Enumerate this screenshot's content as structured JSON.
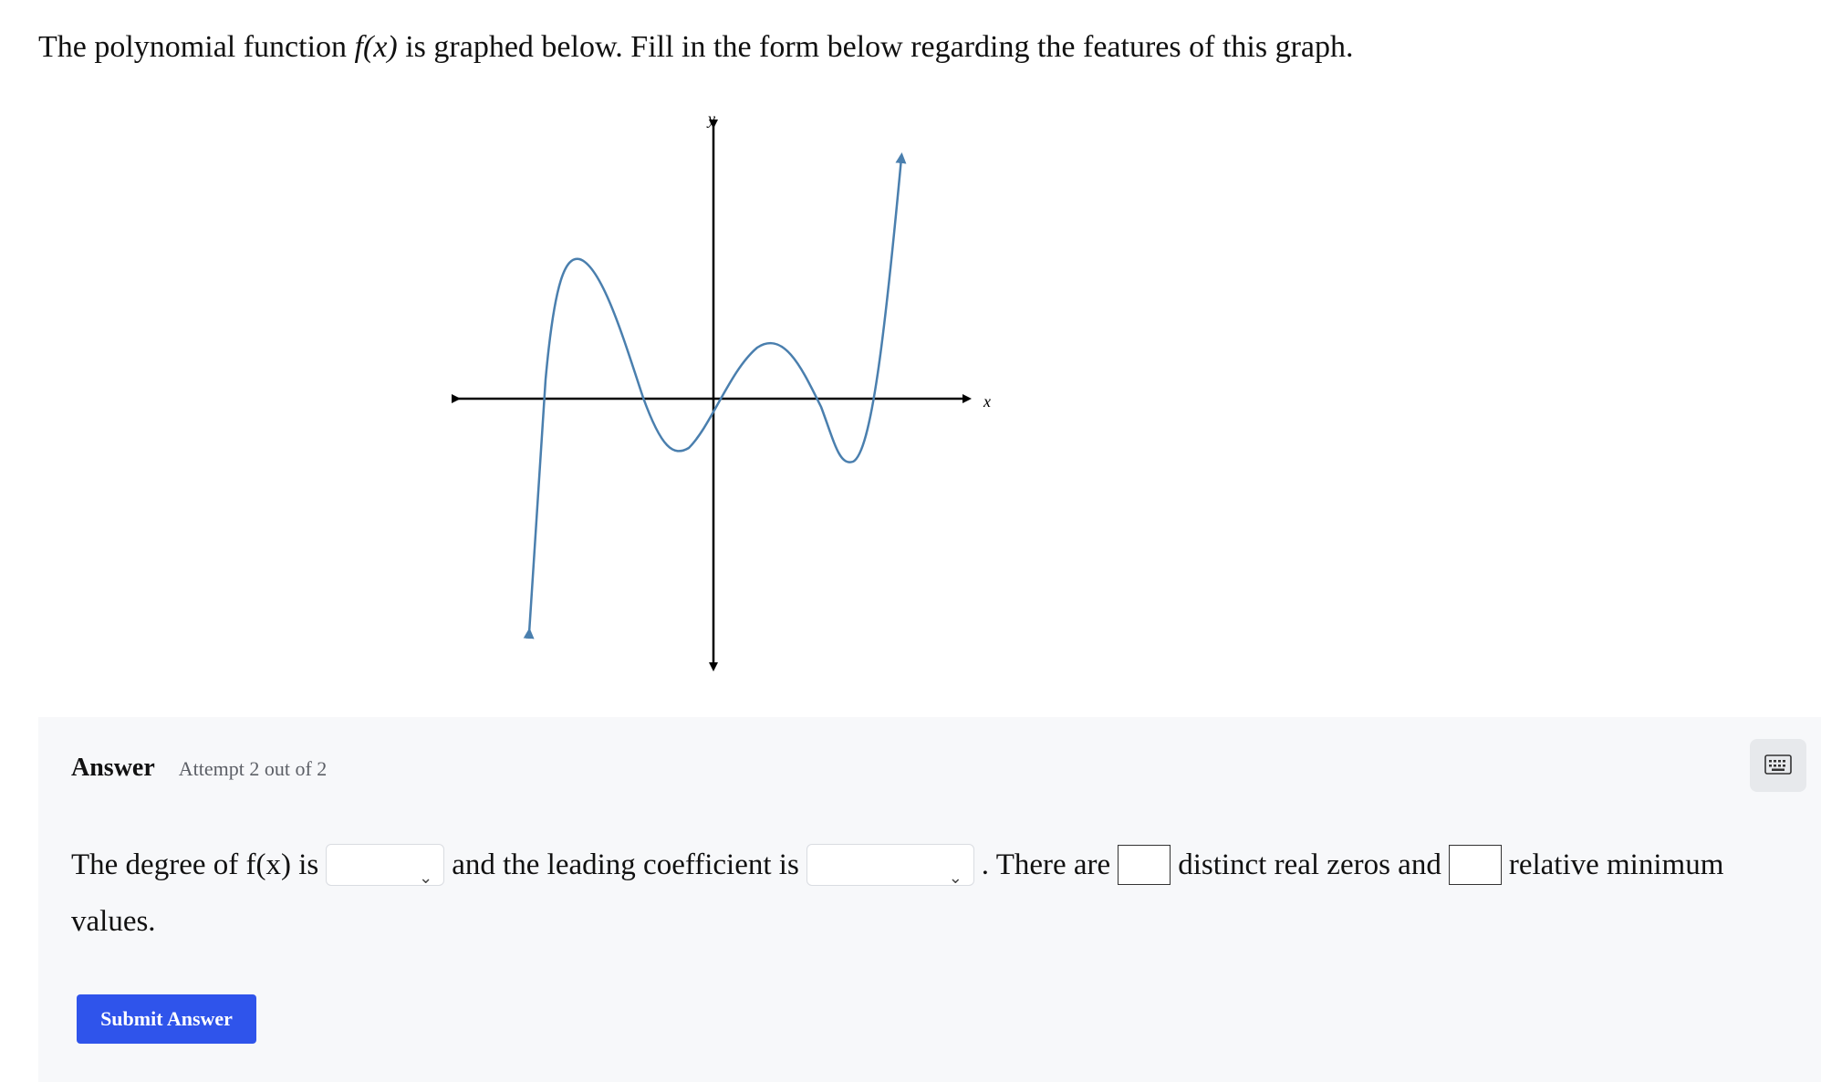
{
  "question": {
    "prefix": "The polynomial function ",
    "func": "f(x)",
    "suffix": " is graphed below. Fill in the form below regarding the features of this graph."
  },
  "graph": {
    "x_axis_label": "x",
    "y_axis_label": "y",
    "curve_color": "#4a7fae",
    "axis_color": "#000000"
  },
  "answer": {
    "title": "Answer",
    "attempt": "Attempt 2 out of 2",
    "keyboard_icon": "keyboard-icon",
    "text_1": "The degree of f(x) is",
    "degree_value": "",
    "text_2": "and the leading coefficient is",
    "leading_coefficient_value": "",
    "text_3": ". There are",
    "zeros_value": "",
    "text_4": "distinct real zeros and",
    "minimums_value": "",
    "text_5": "relative minimum",
    "text_6": "values.",
    "submit_label": "Submit Answer",
    "submit_color": "#2f54eb"
  }
}
